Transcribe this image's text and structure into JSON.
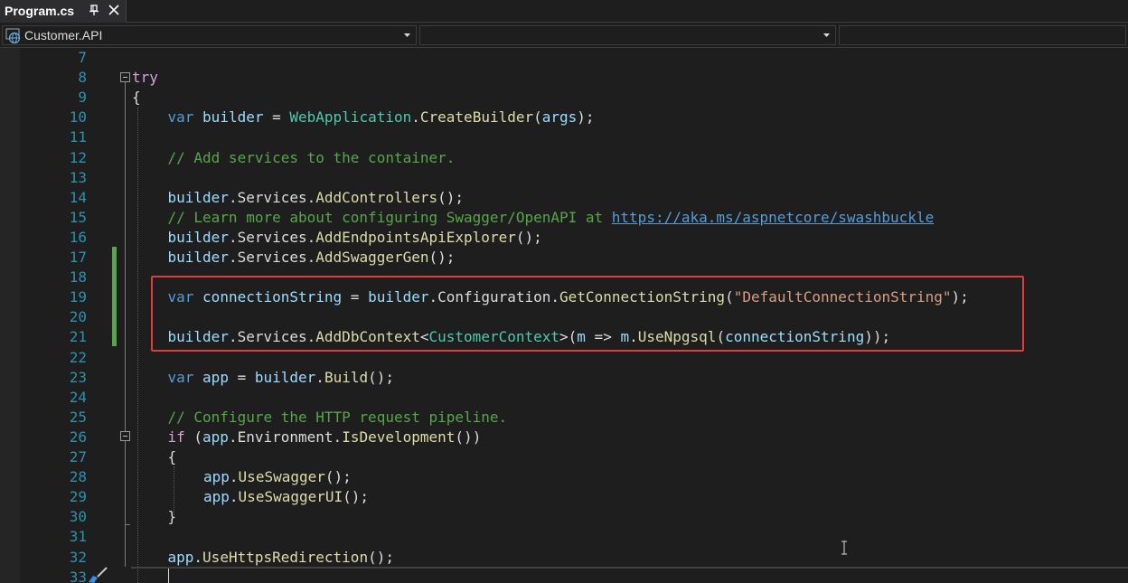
{
  "tab": {
    "title": "Program.cs",
    "pin_icon": "pin-icon",
    "close_icon": "close-icon"
  },
  "nav": {
    "project": "Customer.API",
    "type_member": "",
    "member": ""
  },
  "colors": {
    "background": "#1e1e1e",
    "line_number": "#2b91af",
    "keyword": "#569cd6",
    "identifier": "#9cdcfe",
    "type": "#4ec9b0",
    "method": "#dcdcaa",
    "comment": "#57a64a",
    "string": "#d69d85",
    "control_keyword": "#d8a0df",
    "highlight_box": "#e23b3b",
    "change_bar": "#57a64a"
  },
  "lines": [
    {
      "n": "7",
      "indent": 0,
      "tokens": []
    },
    {
      "n": "8",
      "indent": 0,
      "tokens": [
        [
          "ctrl",
          "try"
        ]
      ]
    },
    {
      "n": "9",
      "indent": 0,
      "tokens": [
        [
          "punc",
          "{"
        ]
      ]
    },
    {
      "n": "10",
      "indent": 1,
      "tokens": [
        [
          "kw",
          "var"
        ],
        [
          "punc",
          " "
        ],
        [
          "id",
          "builder"
        ],
        [
          "punc",
          " = "
        ],
        [
          "type",
          "WebApplication"
        ],
        [
          "punc",
          "."
        ],
        [
          "meth",
          "CreateBuilder"
        ],
        [
          "punc",
          "("
        ],
        [
          "id",
          "args"
        ],
        [
          "punc",
          ");"
        ]
      ]
    },
    {
      "n": "11",
      "indent": 0,
      "tokens": []
    },
    {
      "n": "12",
      "indent": 1,
      "tokens": [
        [
          "com",
          "// Add services to the container."
        ]
      ]
    },
    {
      "n": "13",
      "indent": 0,
      "tokens": []
    },
    {
      "n": "14",
      "indent": 1,
      "tokens": [
        [
          "id",
          "builder"
        ],
        [
          "punc",
          "."
        ],
        [
          "punc",
          "Services"
        ],
        [
          "punc",
          "."
        ],
        [
          "meth",
          "AddControllers"
        ],
        [
          "punc",
          "();"
        ]
      ]
    },
    {
      "n": "15",
      "indent": 1,
      "tokens": [
        [
          "com",
          "// Learn more about configuring Swagger/OpenAPI at "
        ],
        [
          "link",
          "https://aka.ms/aspnetcore/swashbuckle"
        ]
      ]
    },
    {
      "n": "16",
      "indent": 1,
      "tokens": [
        [
          "id",
          "builder"
        ],
        [
          "punc",
          "."
        ],
        [
          "punc",
          "Services"
        ],
        [
          "punc",
          "."
        ],
        [
          "meth",
          "AddEndpointsApiExplorer"
        ],
        [
          "punc",
          "();"
        ]
      ]
    },
    {
      "n": "17",
      "indent": 1,
      "tokens": [
        [
          "id",
          "builder"
        ],
        [
          "punc",
          "."
        ],
        [
          "punc",
          "Services"
        ],
        [
          "punc",
          "."
        ],
        [
          "meth",
          "AddSwaggerGen"
        ],
        [
          "punc",
          "();"
        ]
      ]
    },
    {
      "n": "18",
      "indent": 0,
      "tokens": []
    },
    {
      "n": "19",
      "indent": 1,
      "tokens": [
        [
          "kw",
          "var"
        ],
        [
          "punc",
          " "
        ],
        [
          "id",
          "connectionString"
        ],
        [
          "punc",
          " = "
        ],
        [
          "id",
          "builder"
        ],
        [
          "punc",
          "."
        ],
        [
          "punc",
          "Configuration"
        ],
        [
          "punc",
          "."
        ],
        [
          "meth",
          "GetConnectionString"
        ],
        [
          "punc",
          "("
        ],
        [
          "str",
          "\"DefaultConnectionString\""
        ],
        [
          "punc",
          ");"
        ]
      ]
    },
    {
      "n": "20",
      "indent": 0,
      "tokens": []
    },
    {
      "n": "21",
      "indent": 1,
      "tokens": [
        [
          "id",
          "builder"
        ],
        [
          "punc",
          "."
        ],
        [
          "punc",
          "Services"
        ],
        [
          "punc",
          "."
        ],
        [
          "meth",
          "AddDbContext"
        ],
        [
          "punc",
          "<"
        ],
        [
          "type",
          "CustomerContext"
        ],
        [
          "punc",
          ">("
        ],
        [
          "id",
          "m"
        ],
        [
          "punc",
          " => "
        ],
        [
          "id",
          "m"
        ],
        [
          "punc",
          "."
        ],
        [
          "meth",
          "UseNpgsql"
        ],
        [
          "punc",
          "("
        ],
        [
          "id",
          "connectionString"
        ],
        [
          "punc",
          "));"
        ]
      ]
    },
    {
      "n": "22",
      "indent": 0,
      "tokens": []
    },
    {
      "n": "23",
      "indent": 1,
      "tokens": [
        [
          "kw",
          "var"
        ],
        [
          "punc",
          " "
        ],
        [
          "id",
          "app"
        ],
        [
          "punc",
          " = "
        ],
        [
          "id",
          "builder"
        ],
        [
          "punc",
          "."
        ],
        [
          "meth",
          "Build"
        ],
        [
          "punc",
          "();"
        ]
      ]
    },
    {
      "n": "24",
      "indent": 0,
      "tokens": []
    },
    {
      "n": "25",
      "indent": 1,
      "tokens": [
        [
          "com",
          "// Configure the HTTP request pipeline."
        ]
      ]
    },
    {
      "n": "26",
      "indent": 1,
      "tokens": [
        [
          "ctrl",
          "if"
        ],
        [
          "punc",
          " ("
        ],
        [
          "id",
          "app"
        ],
        [
          "punc",
          "."
        ],
        [
          "punc",
          "Environment"
        ],
        [
          "punc",
          "."
        ],
        [
          "meth",
          "IsDevelopment"
        ],
        [
          "punc",
          "())"
        ]
      ]
    },
    {
      "n": "27",
      "indent": 1,
      "tokens": [
        [
          "punc",
          "{"
        ]
      ]
    },
    {
      "n": "28",
      "indent": 2,
      "tokens": [
        [
          "id",
          "app"
        ],
        [
          "punc",
          "."
        ],
        [
          "meth",
          "UseSwagger"
        ],
        [
          "punc",
          "();"
        ]
      ]
    },
    {
      "n": "29",
      "indent": 2,
      "tokens": [
        [
          "id",
          "app"
        ],
        [
          "punc",
          "."
        ],
        [
          "meth",
          "UseSwaggerUI"
        ],
        [
          "punc",
          "();"
        ]
      ]
    },
    {
      "n": "30",
      "indent": 1,
      "tokens": [
        [
          "punc",
          "}"
        ]
      ]
    },
    {
      "n": "31",
      "indent": 0,
      "tokens": []
    },
    {
      "n": "32",
      "indent": 1,
      "tokens": [
        [
          "id",
          "app"
        ],
        [
          "punc",
          "."
        ],
        [
          "meth",
          "UseHttpsRedirection"
        ],
        [
          "punc",
          "();"
        ]
      ]
    },
    {
      "n": "33",
      "indent": 0,
      "tokens": []
    }
  ]
}
